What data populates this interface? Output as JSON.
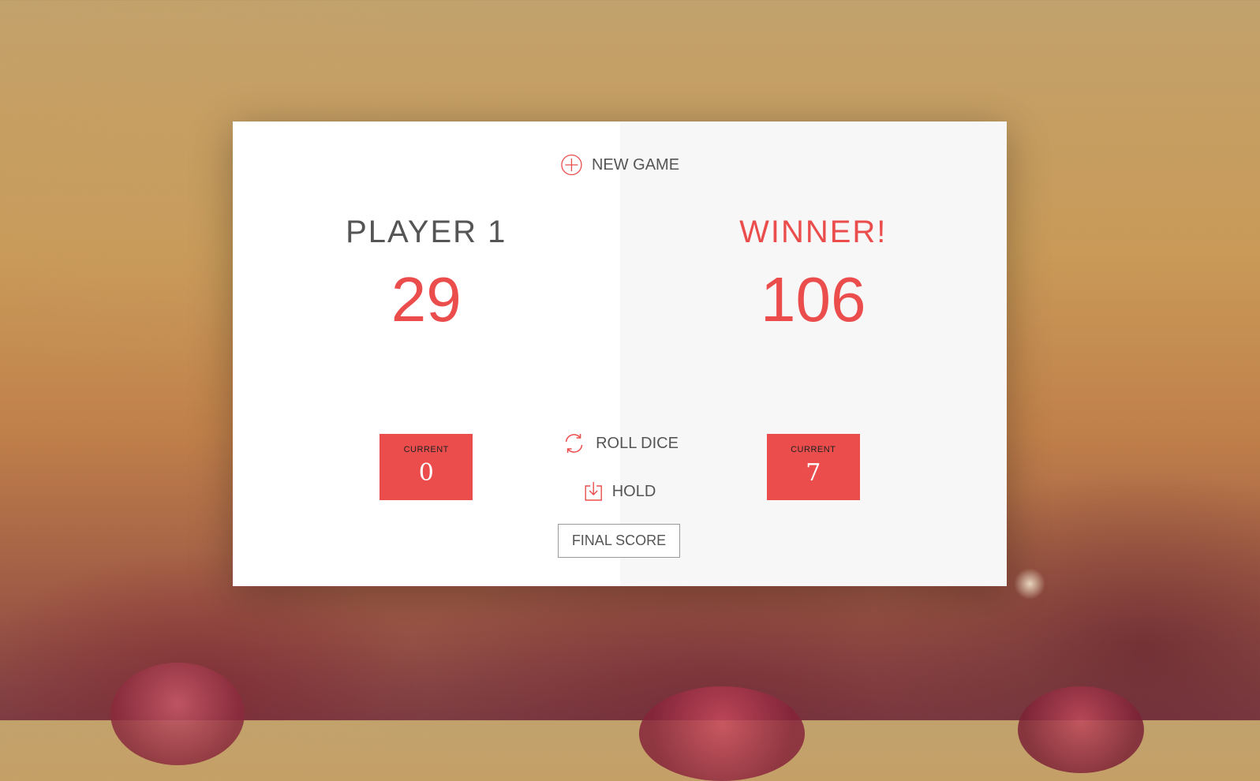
{
  "app": {
    "accent_color": "#EB4D4D"
  },
  "controls": {
    "new_game_label": "NEW GAME",
    "new_game_icon": "plus-circle-icon",
    "roll_dice_label": "ROLL DICE",
    "roll_dice_icon": "refresh-icon",
    "hold_label": "HOLD",
    "hold_icon": "download-icon",
    "final_score_label": "FINAL SCORE"
  },
  "players": [
    {
      "name": "PLAYER 1",
      "score": "29",
      "current_label": "CURRENT",
      "current_score": "0"
    },
    {
      "name": "WINNER!",
      "score": "106",
      "current_label": "CURRENT",
      "current_score": "7"
    }
  ]
}
